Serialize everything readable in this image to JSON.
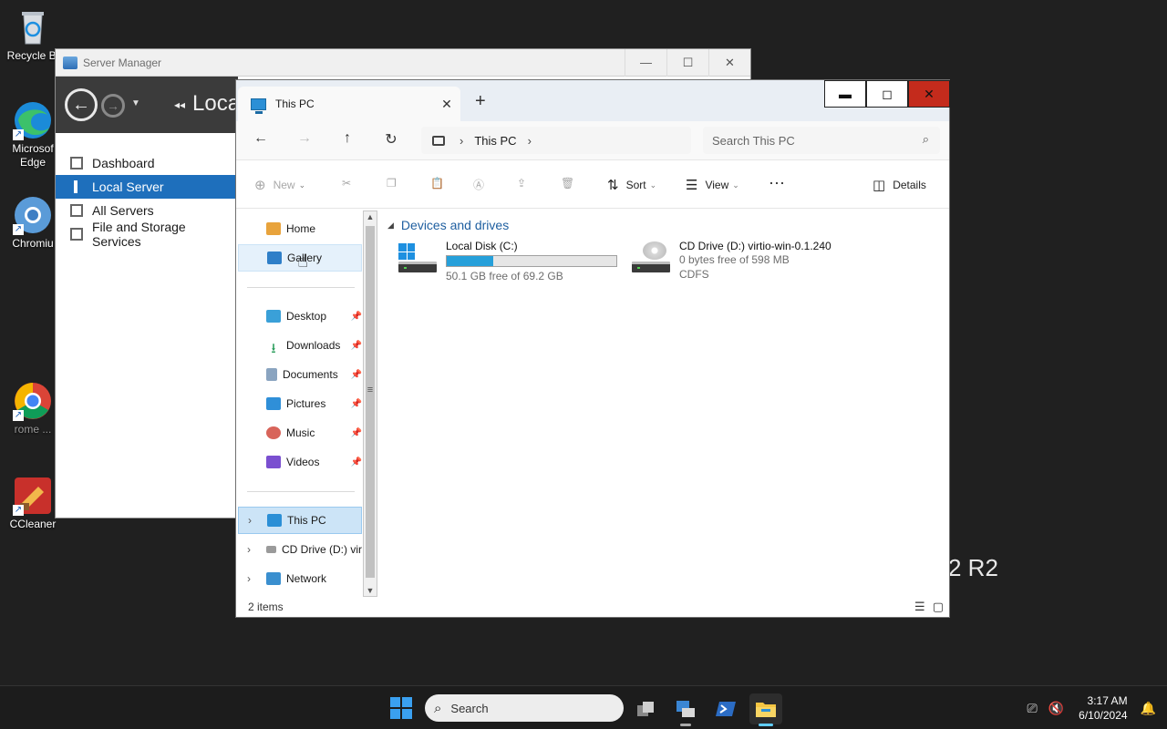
{
  "desktop": {
    "icons": [
      {
        "label": "Recycle Bi"
      },
      {
        "label": "Microsof Edge"
      },
      {
        "label": "Chromiu"
      },
      {
        "label": "rome ..."
      },
      {
        "label": "CCleaner"
      }
    ],
    "bg_text": "2 R2"
  },
  "server_manager": {
    "title": "Server Manager",
    "breadcrumb": "Loca",
    "nav": [
      {
        "label": "Dashboard"
      },
      {
        "label": "Local Server"
      },
      {
        "label": "All Servers"
      },
      {
        "label": "File and Storage Services"
      }
    ]
  },
  "explorer": {
    "tab_title": "This PC",
    "address": {
      "segment": "This PC"
    },
    "search_placeholder": "Search This PC",
    "commands": {
      "new": "New",
      "sort": "Sort",
      "view": "View",
      "details": "Details"
    },
    "nav_pane": {
      "home": "Home",
      "gallery": "Gallery",
      "desktop": "Desktop",
      "downloads": "Downloads",
      "documents": "Documents",
      "pictures": "Pictures",
      "music": "Music",
      "videos": "Videos",
      "this_pc": "This PC",
      "cd_drive": "CD Drive (D:) vir",
      "network": "Network"
    },
    "group_header": "Devices and drives",
    "drives": [
      {
        "name": "Local Disk (C:)",
        "free": "50.1 GB free of 69.2 GB",
        "used_fraction": 0.276
      },
      {
        "name": "CD Drive (D:) virtio-win-0.1.240",
        "free": "0 bytes free of 598 MB",
        "fs": "CDFS"
      }
    ],
    "status": "2 items"
  },
  "taskbar": {
    "search_label": "Search",
    "time": "3:17 AM",
    "date": "6/10/2024"
  },
  "colors": {
    "accent": "#1e6fbc",
    "drive_bar": "#26a0da",
    "close_red": "#c42b1c"
  }
}
